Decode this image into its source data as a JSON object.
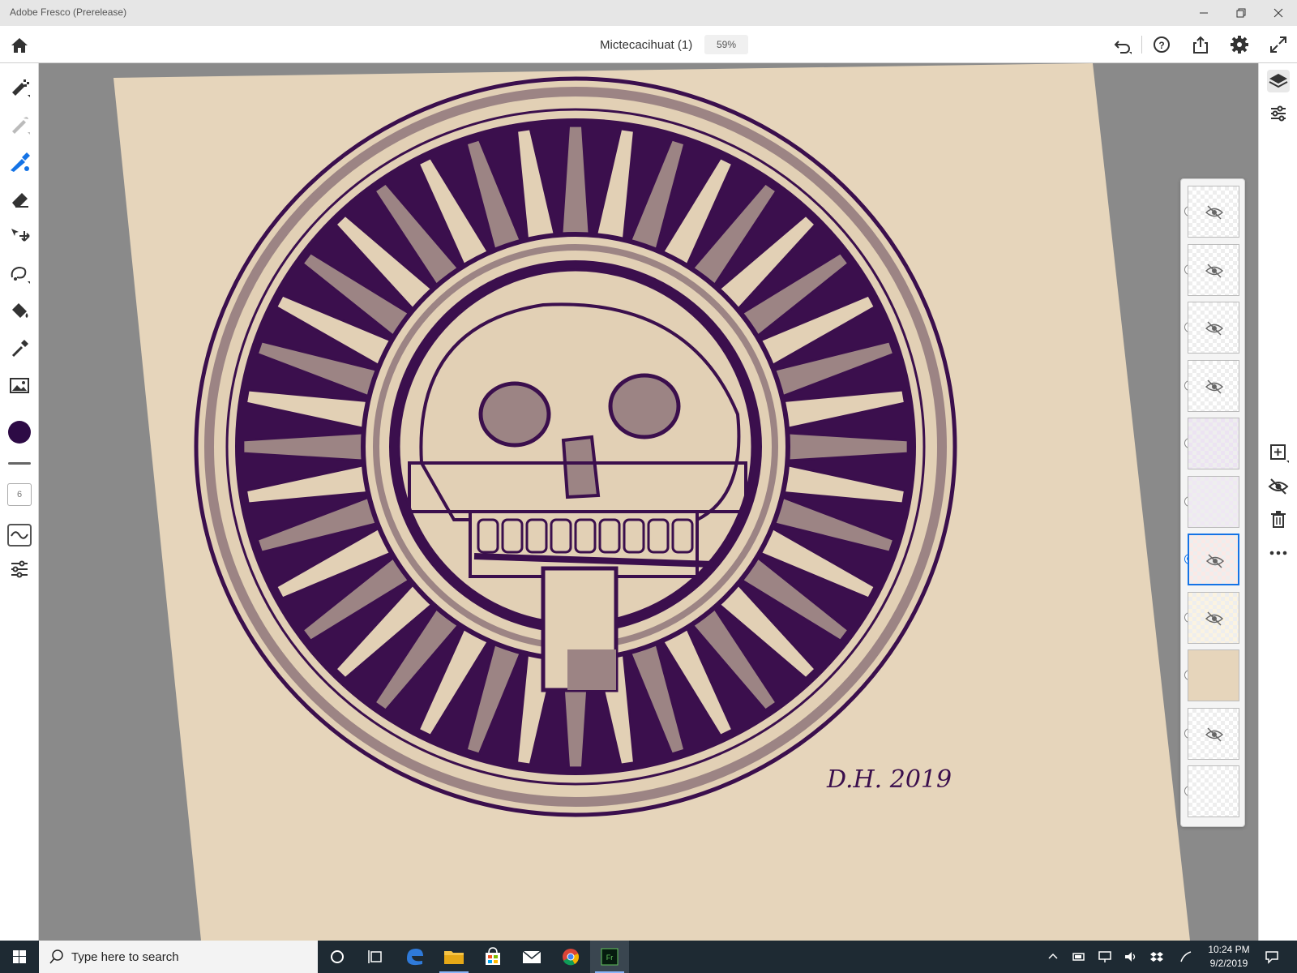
{
  "window": {
    "app_title": "Adobe Fresco (Prerelease)"
  },
  "header": {
    "document_title": "Mictecacihuat (1)",
    "zoom": "59%"
  },
  "toolbar": {
    "brush_size": "6",
    "color": "#2d0a45"
  },
  "layers": [
    {
      "hidden": true,
      "active": false
    },
    {
      "hidden": true,
      "active": false
    },
    {
      "hidden": true,
      "active": false
    },
    {
      "hidden": true,
      "active": false
    },
    {
      "hidden": false,
      "active": false
    },
    {
      "hidden": false,
      "active": false
    },
    {
      "hidden": true,
      "active": true
    },
    {
      "hidden": true,
      "active": false
    },
    {
      "hidden": false,
      "active": false
    },
    {
      "hidden": true,
      "active": false
    },
    {
      "hidden": false,
      "active": false
    }
  ],
  "canvas": {
    "paper_color": "#e6d5bb",
    "ink_color": "#3b0f4d",
    "shade_color": "#9c8484",
    "signature": "D.H. 2019"
  },
  "taskbar": {
    "search_placeholder": "Type here to search",
    "time": "10:24 PM",
    "date": "9/2/2019"
  }
}
